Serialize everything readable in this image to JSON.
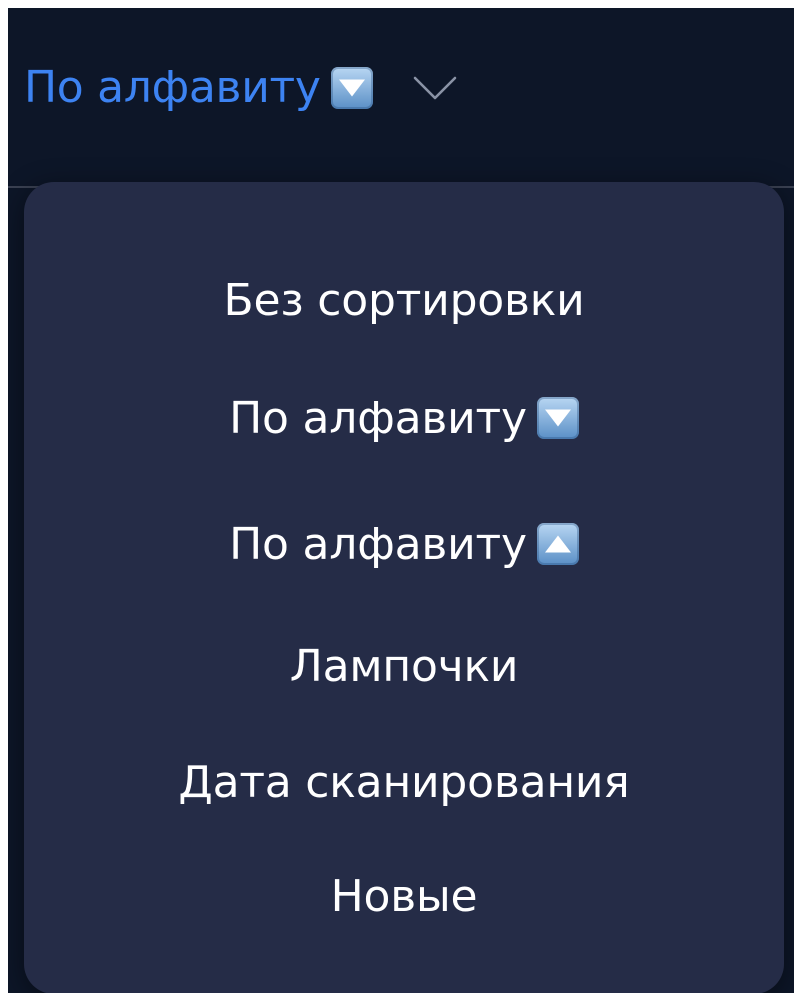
{
  "sort_control": {
    "selected_label": "По алфавиту",
    "selected_icon": "down-arrow-button-emoji",
    "chevron_icon": "chevron-down-icon"
  },
  "sort_menu": {
    "items": [
      {
        "label": "Без сортировки",
        "icon": ""
      },
      {
        "label": "По алфавиту",
        "icon": "down-arrow-button-emoji"
      },
      {
        "label": "По алфавиту",
        "icon": "up-arrow-button-emoji"
      },
      {
        "label": "Лампочки",
        "icon": ""
      },
      {
        "label": "Дата сканирования",
        "icon": ""
      },
      {
        "label": "Новые",
        "icon": ""
      }
    ]
  },
  "colors": {
    "background": "#0d1628",
    "menu_background": "#252c47",
    "accent": "#3d83f2",
    "menu_text": "#ffffff"
  }
}
